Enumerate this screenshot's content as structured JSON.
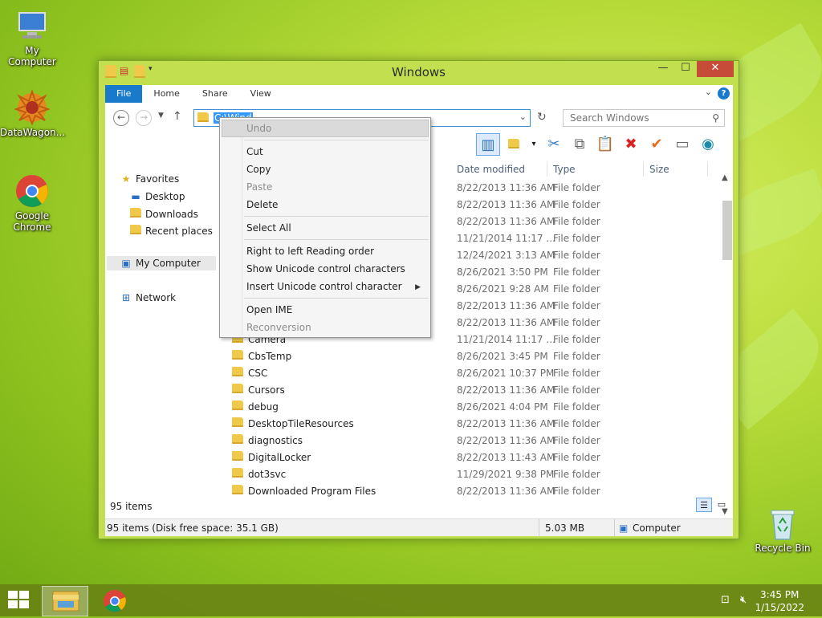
{
  "desktop": {
    "icons": [
      {
        "label": "My Computer"
      },
      {
        "label": "DataWagon..."
      },
      {
        "label": "Google Chrome"
      },
      {
        "label": "Recycle Bin"
      }
    ]
  },
  "window": {
    "title": "Windows",
    "ribbon_tabs": [
      "File",
      "Home",
      "Share",
      "View"
    ],
    "help_label": "?",
    "address_text": "C:\\Wind",
    "search_placeholder": "Search Windows",
    "nav": {
      "favorites": "Favorites",
      "desktop": "Desktop",
      "downloads": "Downloads",
      "recent": "Recent places",
      "computer": "My Computer",
      "network": "Network"
    },
    "columns": {
      "date": "Date modified",
      "type": "Type",
      "size": "Size"
    },
    "rows": [
      {
        "name": "",
        "date": "8/22/2013 11:36 AM",
        "type": "File folder"
      },
      {
        "name": "",
        "date": "8/22/2013 11:36 AM",
        "type": "File folder"
      },
      {
        "name": "",
        "date": "8/22/2013 11:36 AM",
        "type": "File folder"
      },
      {
        "name": "",
        "date": "11/21/2014 11:17 ...",
        "type": "File folder"
      },
      {
        "name": "",
        "date": "12/24/2021 3:13 AM",
        "type": "File folder"
      },
      {
        "name": "",
        "date": "8/26/2021 3:50 PM",
        "type": "File folder"
      },
      {
        "name": "",
        "date": "8/26/2021 9:28 AM",
        "type": "File folder"
      },
      {
        "name": "",
        "date": "8/22/2013 11:36 AM",
        "type": "File folder"
      },
      {
        "name": "",
        "date": "8/22/2013 11:36 AM",
        "type": "File folder"
      },
      {
        "name": "Camera",
        "date": "11/21/2014 11:17 ...",
        "type": "File folder"
      },
      {
        "name": "CbsTemp",
        "date": "8/26/2021 3:45 PM",
        "type": "File folder"
      },
      {
        "name": "CSC",
        "date": "8/26/2021 10:37 PM",
        "type": "File folder"
      },
      {
        "name": "Cursors",
        "date": "8/22/2013 11:36 AM",
        "type": "File folder"
      },
      {
        "name": "debug",
        "date": "8/26/2021 4:04 PM",
        "type": "File folder"
      },
      {
        "name": "DesktopTileResources",
        "date": "8/22/2013 11:36 AM",
        "type": "File folder"
      },
      {
        "name": "diagnostics",
        "date": "8/22/2013 11:36 AM",
        "type": "File folder"
      },
      {
        "name": "DigitalLocker",
        "date": "8/22/2013 11:43 AM",
        "type": "File folder"
      },
      {
        "name": "dot3svc",
        "date": "11/29/2021 9:38 PM",
        "type": "File folder"
      },
      {
        "name": "Downloaded Program Files",
        "date": "8/22/2013 11:36 AM",
        "type": "File folder"
      }
    ],
    "item_count": "95 items",
    "status": {
      "left": "95 items (Disk free space: 35.1 GB)",
      "size": "5.03 MB",
      "location": "Computer"
    }
  },
  "context_menu": {
    "items": [
      {
        "label": "Undo",
        "enabled": false
      },
      {
        "label": "Cut",
        "enabled": true
      },
      {
        "label": "Copy",
        "enabled": true
      },
      {
        "label": "Paste",
        "enabled": false
      },
      {
        "label": "Delete",
        "enabled": true
      },
      {
        "label": "Select All",
        "enabled": true
      },
      {
        "label": "Right to left Reading order",
        "enabled": true
      },
      {
        "label": "Show Unicode control characters",
        "enabled": true
      },
      {
        "label": "Insert Unicode control character",
        "enabled": true
      },
      {
        "label": "Open IME",
        "enabled": true
      },
      {
        "label": "Reconversion",
        "enabled": false
      }
    ]
  },
  "taskbar": {
    "time": "3:45 PM",
    "date": "1/15/2022"
  }
}
